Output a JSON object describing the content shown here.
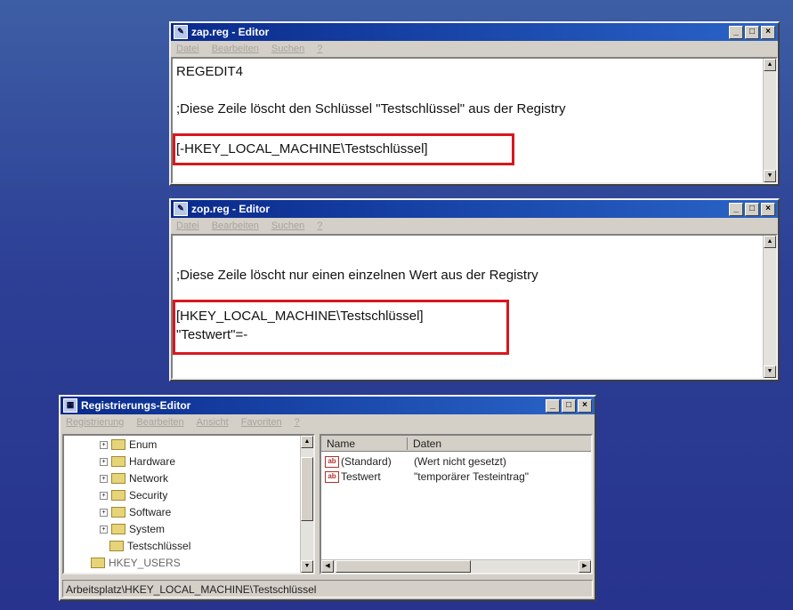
{
  "editor1": {
    "title": "zap.reg - Editor",
    "menu": [
      "Datei",
      "Bearbeiten",
      "Suchen",
      "?"
    ],
    "lines": [
      "REGEDIT4",
      ";Diese Zeile löscht den Schlüssel \"Testschlüssel\"  aus der Registry",
      "[-HKEY_LOCAL_MACHINE\\Testschlüssel]"
    ]
  },
  "editor2": {
    "title": "zop.reg - Editor",
    "menu": [
      "Datei",
      "Bearbeiten",
      "Suchen",
      "?"
    ],
    "lines": [
      ";Diese Zeile löscht nur einen einzelnen Wert aus der Registry",
      "[HKEY_LOCAL_MACHINE\\Testschlüssel]",
      "\"Testwert\"=-"
    ]
  },
  "regedit": {
    "title": "Registrierungs-Editor",
    "menu": [
      "Registrierung",
      "Bearbeiten",
      "Ansicht",
      "Favoriten",
      "?"
    ],
    "tree": [
      "Enum",
      "Hardware",
      "Network",
      "Security",
      "Software",
      "System",
      "Testschlüssel",
      "HKEY_USERS"
    ],
    "columns": [
      "Name",
      "Daten"
    ],
    "rows": [
      {
        "name": "(Standard)",
        "data": "(Wert nicht gesetzt)"
      },
      {
        "name": "Testwert",
        "data": "\"temporärer Testeintrag\""
      }
    ],
    "status": "Arbeitsplatz\\HKEY_LOCAL_MACHINE\\Testschlüssel"
  },
  "colors": {
    "highlight": "#d8171e",
    "titlebar": "#0a2a8c"
  }
}
